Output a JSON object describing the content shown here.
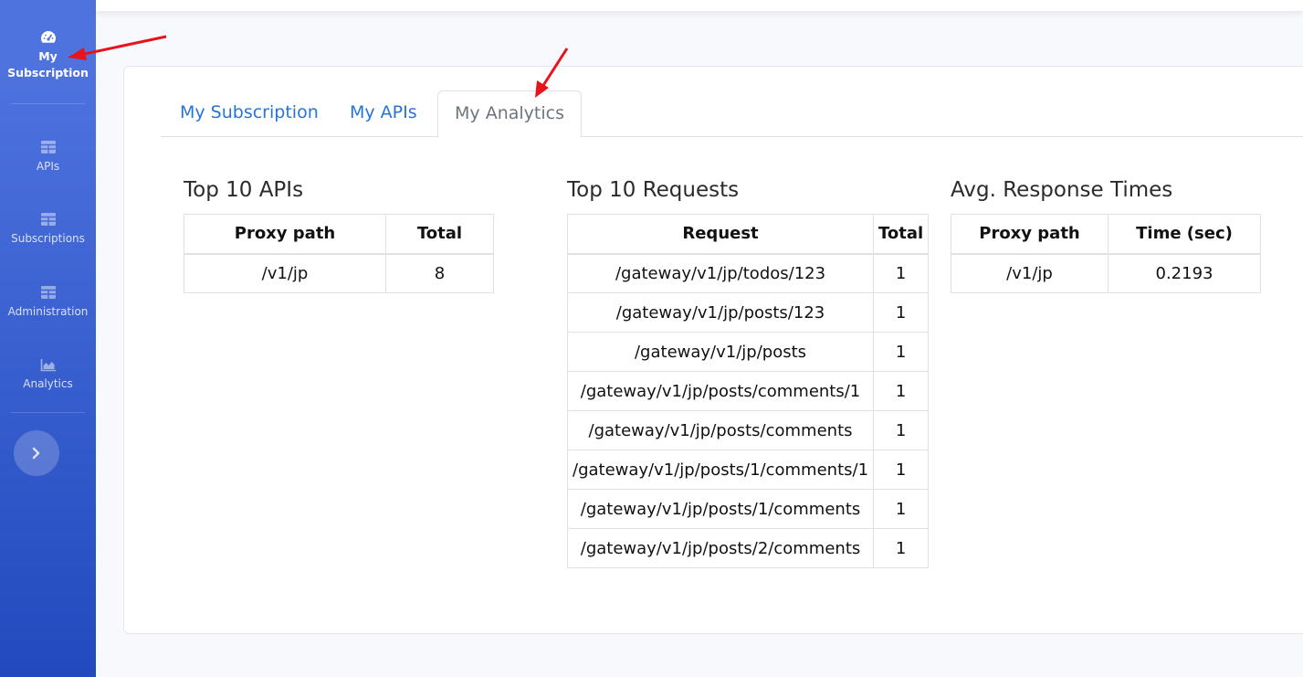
{
  "sidebar": {
    "items": [
      {
        "label": "My Subscription",
        "icon": "tachometer-icon",
        "active": true
      },
      {
        "label": "APIs",
        "icon": "table-icon"
      },
      {
        "label": "Subscriptions",
        "icon": "table-icon"
      },
      {
        "label": "Administration",
        "icon": "table-icon"
      },
      {
        "label": "Analytics",
        "icon": "chart-area-icon"
      }
    ],
    "toggle_icon": "chevron-right-icon"
  },
  "tabs": [
    {
      "label": "My Subscription"
    },
    {
      "label": "My APIs"
    },
    {
      "label": "My Analytics",
      "active": true
    }
  ],
  "top_apis": {
    "title": "Top 10 APIs",
    "headers": [
      "Proxy path",
      "Total"
    ],
    "rows": [
      [
        "/v1/jp",
        "8"
      ]
    ]
  },
  "top_requests": {
    "title": "Top 10 Requests",
    "headers": [
      "Request",
      "Total"
    ],
    "rows": [
      [
        "/gateway/v1/jp/todos/123",
        "1"
      ],
      [
        "/gateway/v1/jp/posts/123",
        "1"
      ],
      [
        "/gateway/v1/jp/posts",
        "1"
      ],
      [
        "/gateway/v1/jp/posts/comments/1",
        "1"
      ],
      [
        "/gateway/v1/jp/posts/comments",
        "1"
      ],
      [
        "/gateway/v1/jp/posts/1/comments/1",
        "1"
      ],
      [
        "/gateway/v1/jp/posts/1/comments",
        "1"
      ],
      [
        "/gateway/v1/jp/posts/2/comments",
        "1"
      ]
    ]
  },
  "avg_response": {
    "title": "Avg. Response Times",
    "headers": [
      "Proxy path",
      "Time (sec)"
    ],
    "rows": [
      [
        "/v1/jp",
        "0.2193"
      ]
    ]
  },
  "colors": {
    "sidebar_start": "#4e73df",
    "sidebar_end": "#224abe",
    "tab_link": "#2774d8",
    "annotation_arrow": "#e8141c"
  }
}
